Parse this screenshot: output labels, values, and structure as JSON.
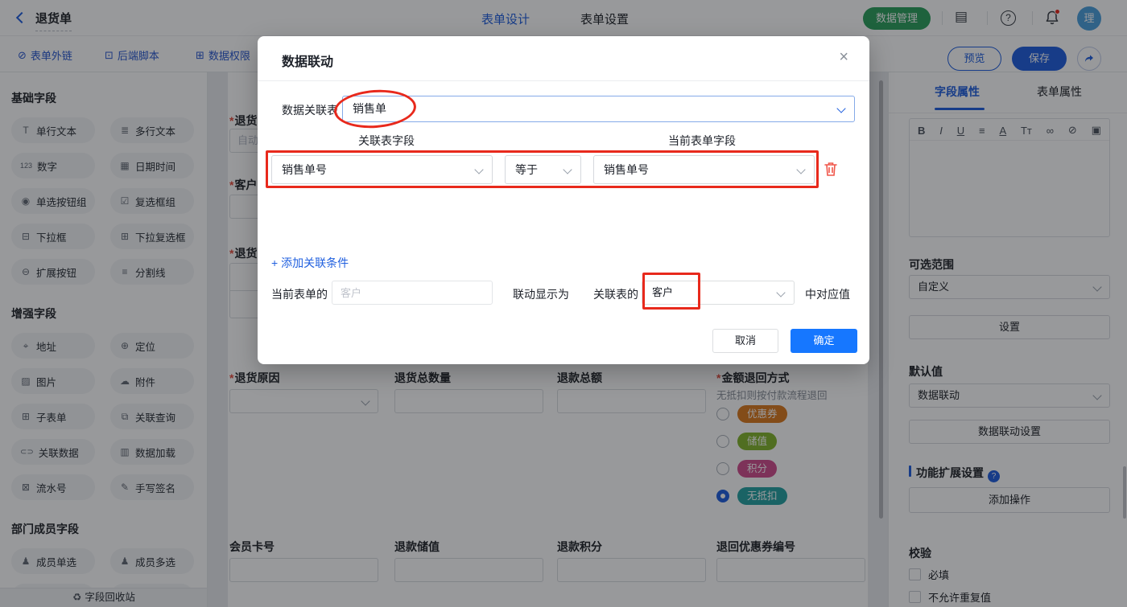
{
  "topbar": {
    "title": "退货单",
    "tabs": [
      {
        "label": "表单设计",
        "active": true
      },
      {
        "label": "表单设置",
        "active": false
      }
    ],
    "data_manage_label": "数据管理",
    "avatar_text": "理"
  },
  "toolbar": {
    "links": [
      {
        "icon": "⊘",
        "label": "表单外链"
      },
      {
        "icon": "⊡",
        "label": "后端脚本"
      },
      {
        "icon": "⊞",
        "label": "数据权限"
      }
    ],
    "preview_label": "预览",
    "save_label": "保存"
  },
  "sidebar": {
    "sections": [
      {
        "title": "基础字段",
        "items": [
          {
            "icon": "T",
            "label": "单行文本"
          },
          {
            "icon": "≣",
            "label": "多行文本"
          },
          {
            "icon": "123",
            "label": "数字"
          },
          {
            "icon": "▦",
            "label": "日期时间"
          },
          {
            "icon": "◉",
            "label": "单选按钮组"
          },
          {
            "icon": "☑",
            "label": "复选框组"
          },
          {
            "icon": "⊟",
            "label": "下拉框"
          },
          {
            "icon": "⊞",
            "label": "下拉复选框"
          },
          {
            "icon": "⊖",
            "label": "扩展按钮"
          },
          {
            "icon": "≡",
            "label": "分割线"
          }
        ]
      },
      {
        "title": "增强字段",
        "items": [
          {
            "icon": "⌖",
            "label": "地址"
          },
          {
            "icon": "⊕",
            "label": "定位"
          },
          {
            "icon": "▨",
            "label": "图片"
          },
          {
            "icon": "☁",
            "label": "附件"
          },
          {
            "icon": "⊞",
            "label": "子表单"
          },
          {
            "icon": "⧉",
            "label": "关联查询"
          },
          {
            "icon": "⊂⊃",
            "label": "关联数据"
          },
          {
            "icon": "▥",
            "label": "数据加载"
          },
          {
            "icon": "⊠",
            "label": "流水号"
          },
          {
            "icon": "✎",
            "label": "手写签名"
          }
        ]
      },
      {
        "title": "部门成员字段",
        "items": [
          {
            "icon": "♟",
            "label": "成员单选"
          },
          {
            "icon": "♟",
            "label": "成员多选"
          }
        ]
      }
    ],
    "recycle_icon": "♻",
    "recycle_label": "字段回收站"
  },
  "canvas": {
    "hidden_fields": {
      "f1_label": "退货单",
      "f1_value": "自动",
      "f2_label": "客户",
      "f3_label": "退货"
    },
    "row1": {
      "c1_label": "退货原因",
      "c2_label": "退货总数量",
      "c3_label": "退款总额"
    },
    "payback": {
      "label": "金额退回方式",
      "hint": "无抵扣则按付款流程退回",
      "options": [
        {
          "label": "优惠券",
          "color": "#db7a1f",
          "selected": false
        },
        {
          "label": "储值",
          "color": "#84b52e",
          "selected": false
        },
        {
          "label": "积分",
          "color": "#d14f8d",
          "selected": false
        },
        {
          "label": "无抵扣",
          "color": "#27a2a2",
          "selected": true
        }
      ]
    },
    "row2": {
      "c1_label": "会员卡号",
      "c2_label": "退款储值",
      "c3_label": "退款积分",
      "c4_label": "退回优惠券编号"
    }
  },
  "modal": {
    "title": "数据联动",
    "close": "×",
    "table_label": "数据关联表",
    "table_value": "销售单",
    "col_left": "关联表字段",
    "col_right": "当前表单字段",
    "condition": {
      "left": "销售单号",
      "op": "等于",
      "right": "销售单号"
    },
    "add_condition": "+ 添加关联条件",
    "display": {
      "prefix": "当前表单的",
      "placeholder": "客户",
      "mid": "联动显示为",
      "rel": "关联表的",
      "field": "客户",
      "suffix": "中对应值"
    },
    "cancel_label": "取消",
    "ok_label": "确定"
  },
  "rightbar": {
    "tabs": [
      {
        "label": "字段属性",
        "active": true
      },
      {
        "label": "表单属性",
        "active": false
      }
    ],
    "editor_icons": [
      "B",
      "I",
      "U",
      "≡",
      "A",
      "Tт",
      "∞",
      "⊘",
      "▣"
    ],
    "optional_range": {
      "label": "可选范围",
      "value": "自定义",
      "button": "设置"
    },
    "default_value": {
      "label": "默认值",
      "value": "数据联动",
      "button": "数据联动设置"
    },
    "extension": {
      "label": "功能扩展设置",
      "help": "?",
      "button": "添加操作"
    },
    "validation": {
      "label": "校验",
      "check1": "必填",
      "check2": "不允许重复值"
    }
  },
  "colors": {
    "primary": "#2160df",
    "ok_button": "#1677ff",
    "annotation_red": "#e8291c",
    "manage_green": "#2da05e",
    "avatar_blue": "#4da0dd"
  }
}
